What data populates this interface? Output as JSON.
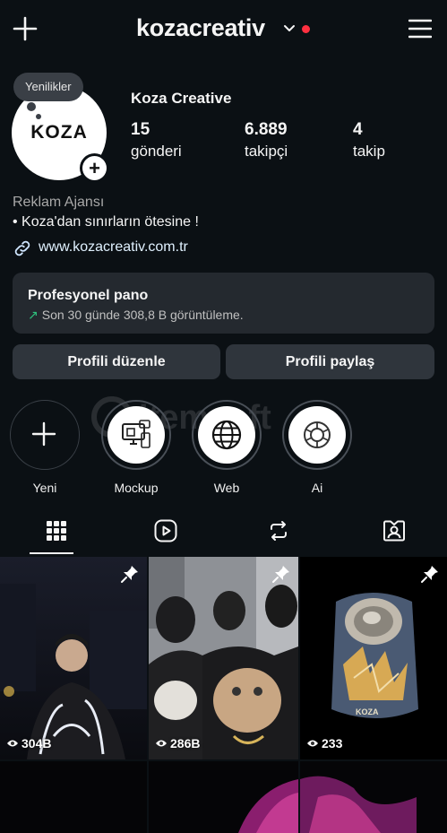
{
  "header": {
    "username": "kozacreativ",
    "add_icon": "plus-icon",
    "menu_icon": "hamburger-menu-icon"
  },
  "profile": {
    "avatar_logo_text": "KOZA",
    "notes_tooltip": "Yenilikler",
    "full_name": "Koza Creative",
    "stats": [
      {
        "value": "15",
        "label": "gönderi"
      },
      {
        "value": "6.889",
        "label": "takipçi"
      },
      {
        "value": "4",
        "label": "takip"
      }
    ],
    "category": "Reklam Ajansı",
    "bio": "• Koza'dan sınırların ötesine !",
    "link": "www.kozacreativ.com.tr"
  },
  "dashboard": {
    "title": "Profesyonel pano",
    "subtitle": "Son 30 günde 308,8 B görüntüleme.",
    "arrow": "↗"
  },
  "buttons": {
    "edit_profile": "Profili düzenle",
    "share_profile": "Profili paylaş"
  },
  "highlights": [
    {
      "label": "Yeni",
      "icon": "plus-icon"
    },
    {
      "label": "Mockup",
      "icon": "mockup-icon"
    },
    {
      "label": "Web",
      "icon": "globe-icon"
    },
    {
      "label": "Ai",
      "icon": "ai-icon"
    }
  ],
  "tabs": [
    {
      "name": "grid",
      "icon": "grid-icon",
      "active": true
    },
    {
      "name": "reels",
      "icon": "reels-icon",
      "active": false
    },
    {
      "name": "reposts",
      "icon": "repost-icon",
      "active": false
    },
    {
      "name": "tagged",
      "icon": "tagged-icon",
      "active": false
    }
  ],
  "posts": [
    {
      "views": "304B",
      "pinned": true
    },
    {
      "views": "286B",
      "pinned": true
    },
    {
      "views": "233",
      "pinned": true
    }
  ],
  "colors": {
    "background": "#0b1014",
    "card": "#24292f",
    "button": "#2f353c",
    "notification_dot": "#ff3040",
    "trend_green": "#2ec27e",
    "link": "#e0f1ff"
  }
}
